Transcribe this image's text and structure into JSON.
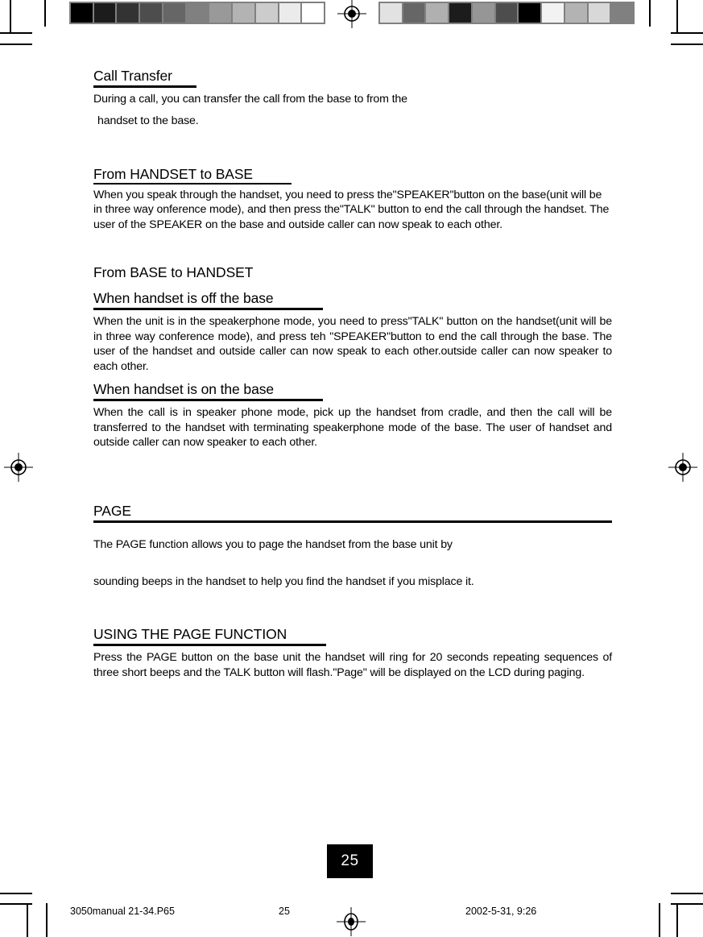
{
  "document": {
    "page_badge_number": "25",
    "calibration_bars": {
      "left_label": "grayscale-step-wedge",
      "left_swatches": [
        "#000000",
        "#1c1c1c",
        "#333333",
        "#4d4d4d",
        "#666666",
        "#808080",
        "#999999",
        "#b3b3b3",
        "#cccccc",
        "#ebebeb",
        "#ffffff"
      ],
      "right_label": "grayscale-random-patches",
      "right_swatches": [
        "#e2e2e2",
        "#666666",
        "#b0b0b0",
        "#1c1c1c",
        "#969696",
        "#4d4d4d",
        "#000000",
        "#f2f2f2",
        "#b3b3b3",
        "#d8d8d8",
        "#808080"
      ]
    },
    "footer": {
      "file_name": "3050manual 21-34.P65",
      "page_number": "25",
      "timestamp": "2002-5-31, 9:26"
    }
  },
  "content": {
    "call_transfer": {
      "heading": "Call Transfer",
      "intro_line_1": "During a call, you can transfer the call from the base to from the",
      "intro_line_2": "handset to the base."
    },
    "handset_to_base": {
      "heading": "From HANDSET to BASE",
      "body": "When you speak through the handset, you need to press the\"SPEAKER\"button on the base(unit will be in three way onference mode), and then press the\"TALK\" button to end the call through the handset. The user of the SPEAKER on the base and outside caller can now speak to each other."
    },
    "base_to_handset": {
      "heading": "From BASE to  HANDSET",
      "off_base": {
        "heading": "When handset is off the base",
        "body": "When the unit is in the speakerphone mode, you need to press\"TALK\" button on the handset(unit will be in three way conference mode), and press teh \"SPEAKER\"button to end the call through the base. The user of the handset and outside caller can now speak to each other.outside caller can now speaker to each other."
      },
      "on_base": {
        "heading": "When handset is on the base",
        "body": "When the call is in speaker phone mode, pick up the handset from cradle, and then the call will be transferred to the  handset with terminating speakerphone mode of the base. The user of handset and outside caller can now speaker to each other."
      }
    },
    "page_function": {
      "heading": "PAGE",
      "intro_line_1": "The PAGE function allows you to page the handset from the base unit by",
      "intro_line_2": "sounding beeps in the handset to help you find the handset if you misplace it.",
      "using": {
        "heading": "USING THE PAGE FUNCTION",
        "body": "Press the PAGE button on the base unit the handset will ring for 20 seconds repeating sequences of three short beeps and the TALK button will flash.\"Page\" will be displayed on the LCD during paging."
      }
    }
  }
}
